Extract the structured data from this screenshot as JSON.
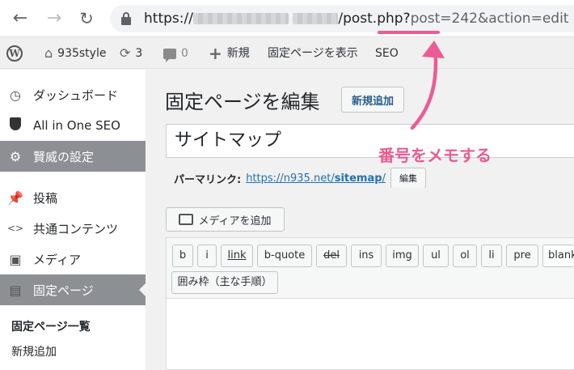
{
  "browser": {
    "url_prefix": "https://",
    "url_path": "/post.php?",
    "url_query_highlight": "post=242",
    "url_query_rest": "&action=edit"
  },
  "adminbar": {
    "site_name": "935style",
    "updates_count": "3",
    "comments_count": "0",
    "new_label": "新規",
    "view_page_label": "固定ページを表示",
    "seo_label": "SEO"
  },
  "sidebar": {
    "items": [
      {
        "label": "ダッシュボード",
        "icon": "dashboard-icon"
      },
      {
        "label": "All in One SEO",
        "icon": "shield-icon"
      },
      {
        "label": "賢威の設定",
        "icon": "gear-icon"
      },
      {
        "label": "投稿",
        "icon": "pin-icon"
      },
      {
        "label": "共通コンテンツ",
        "icon": "code-icon"
      },
      {
        "label": "メディア",
        "icon": "media-icon"
      },
      {
        "label": "固定ページ",
        "icon": "page-icon"
      }
    ],
    "submenu": [
      {
        "label": "固定ページ一覧"
      },
      {
        "label": "新規追加"
      }
    ]
  },
  "main": {
    "page_title": "固定ページを編集",
    "add_new_label": "新規追加",
    "post_title": "サイトマップ",
    "permalink_label": "パーマリンク:",
    "permalink_url_base": "https://n935.net/",
    "permalink_slug": "sitemap",
    "permalink_trailing": "/",
    "edit_slug_label": "編集",
    "add_media_label": "メディアを追加",
    "quicktags": [
      "b",
      "i",
      "link",
      "b-quote",
      "del",
      "ins",
      "img",
      "ul",
      "ol",
      "li",
      "pre",
      "blank"
    ],
    "extra_quicktag": "囲み枠（主な手順）"
  },
  "annotation": {
    "text": "番号をメモする",
    "color": "#ec5b93"
  }
}
